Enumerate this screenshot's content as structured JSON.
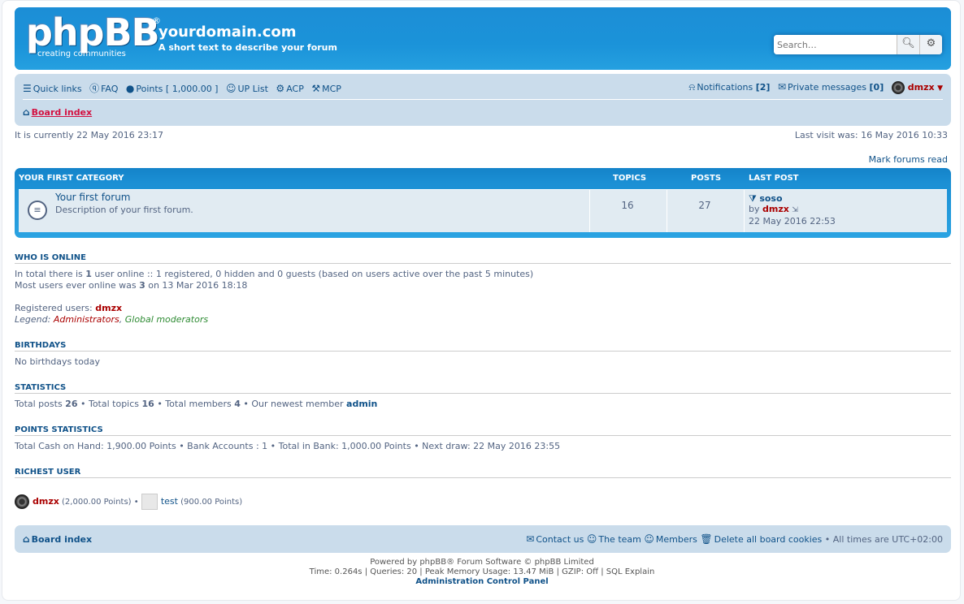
{
  "header": {
    "logo_text": "phpBB",
    "logo_reg": "®",
    "logo_sub": "creating   communities",
    "site_title": "yourdomain.com",
    "site_desc": "A short text to describe your forum",
    "search_placeholder": "Search…"
  },
  "navbar": {
    "quick_links": "Quick links",
    "faq": "FAQ",
    "points": "Points  [ 1,000.00 ]",
    "up_list": "UP List",
    "acp": "ACP",
    "mcp": "MCP",
    "notifications": "Notifications",
    "notifications_count": "[2]",
    "private_messages": "Private messages",
    "pm_count": "[0]",
    "username": "dmzx",
    "breadcrumb": "Board index"
  },
  "info": {
    "current_time": "It is currently 22 May 2016 23:17",
    "last_visit": "Last visit was: 16 May 2016 10:33",
    "mark_read": "Mark forums read"
  },
  "forums": {
    "category": "YOUR FIRST CATEGORY",
    "col_topics": "TOPICS",
    "col_posts": "POSTS",
    "col_lastpost": "LAST POST",
    "rows": [
      {
        "name": "Your first forum",
        "description": "Description of your first forum.",
        "topics": "16",
        "posts": "27",
        "last_title": "soso",
        "last_by_prefix": "by",
        "last_by": "dmzx",
        "last_date": "22 May 2016 22:53"
      }
    ]
  },
  "who_online": {
    "title": "WHO IS ONLINE",
    "line1_a": "In total there is ",
    "line1_num": "1",
    "line1_b": " user online :: 1 registered, 0 hidden and 0 guests (based on users active over the past 5 minutes)",
    "line2_a": "Most users ever online was ",
    "line2_num": "3",
    "line2_b": " on 13 Mar 2016 18:18",
    "registered_label": "Registered users: ",
    "registered_user": "dmzx",
    "legend_label": "Legend: ",
    "legend_admin": "Administrators",
    "legend_sep": ", ",
    "legend_mods": "Global moderators"
  },
  "birthdays": {
    "title": "BIRTHDAYS",
    "text": "No birthdays today"
  },
  "statistics": {
    "title": "STATISTICS",
    "posts_label": "Total posts ",
    "posts": "26",
    "topics_label": " • Total topics ",
    "topics": "16",
    "members_label": " • Total members ",
    "members": "4",
    "newest_label": " • Our newest member ",
    "newest": "admin"
  },
  "points_stats": {
    "title": "POINTS STATISTICS",
    "text": "Total Cash on Hand: 1,900.00 Points • Bank Accounts : 1 • Total in Bank: 1,000.00 Points • Next draw: 22 May 2016 23:55"
  },
  "richest": {
    "title": "RICHEST USER",
    "user1": "dmzx",
    "user1_points": " (2,000.00 Points) • ",
    "user2": "test",
    "user2_points": " (900.00 Points)"
  },
  "footer": {
    "board_index": "Board index",
    "contact": "Contact us",
    "team": "The team",
    "members": "Members",
    "delete_cookies": "Delete all board cookies",
    "timezone": "• All times are UTC+02:00",
    "powered": "Powered by phpBB® Forum Software © phpBB Limited",
    "stats": "Time: 0.264s | Queries: 20 | Peak Memory Usage: 13.47 MiB | GZIP: Off | SQL Explain",
    "acp": "Administration Control Panel"
  }
}
